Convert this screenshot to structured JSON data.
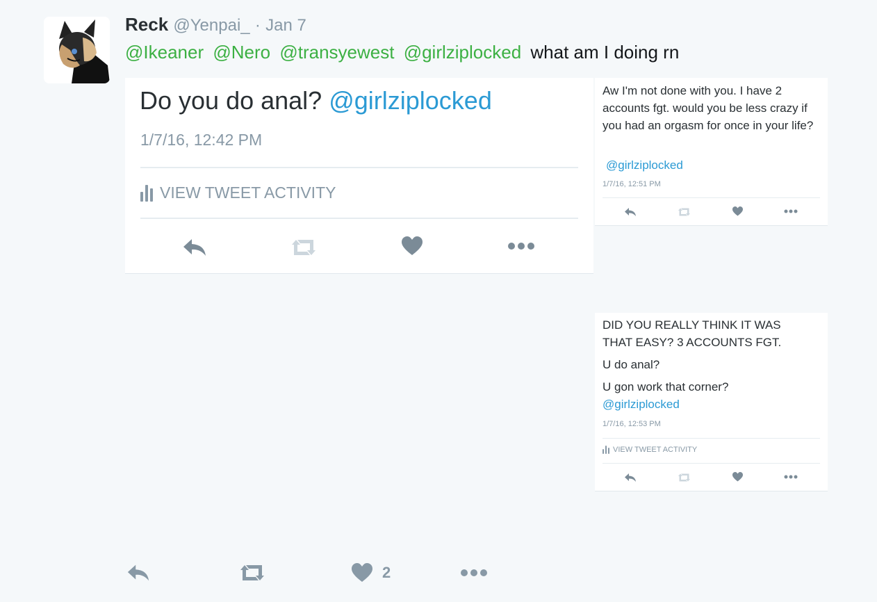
{
  "author": {
    "name": "Reck",
    "handle": "@Yenpai_",
    "separator": "·",
    "date": "Jan 7"
  },
  "tweet": {
    "mentions": [
      "@Ikeaner",
      "@Nero",
      "@transyewest",
      "@girlziplocked"
    ],
    "text": "what am I doing rn"
  },
  "media": {
    "main": {
      "body": "Do you do anal?",
      "mention": "@girlziplocked",
      "timestamp": "1/7/16, 12:42 PM",
      "activity_label": "VIEW TWEET ACTIVITY"
    },
    "reply1": {
      "body": "Aw I'm not done with you. I have 2 accounts fgt. would you be less crazy if you had an orgasm for once in your life?",
      "mention": "@girlziplocked",
      "timestamp": "1/7/16, 12:51 PM"
    },
    "reply2": {
      "line1": "DID YOU REALLY  THINK IT WAS THAT EASY? 3 ACCOUNTS FGT.",
      "line2": "U do anal?",
      "line3": "U gon work that corner?",
      "mention": "@girlziplocked",
      "timestamp": "1/7/16, 12:53 PM",
      "activity_label": "VIEW TWEET ACTIVITY"
    }
  },
  "actions": {
    "like_count": "2"
  },
  "colors": {
    "background": "#f5f8fa",
    "mention_green": "#3cb043",
    "mention_blue": "#2b9ad4",
    "icon_gray": "#8899a6",
    "icon_light": "#ccd6dd"
  }
}
